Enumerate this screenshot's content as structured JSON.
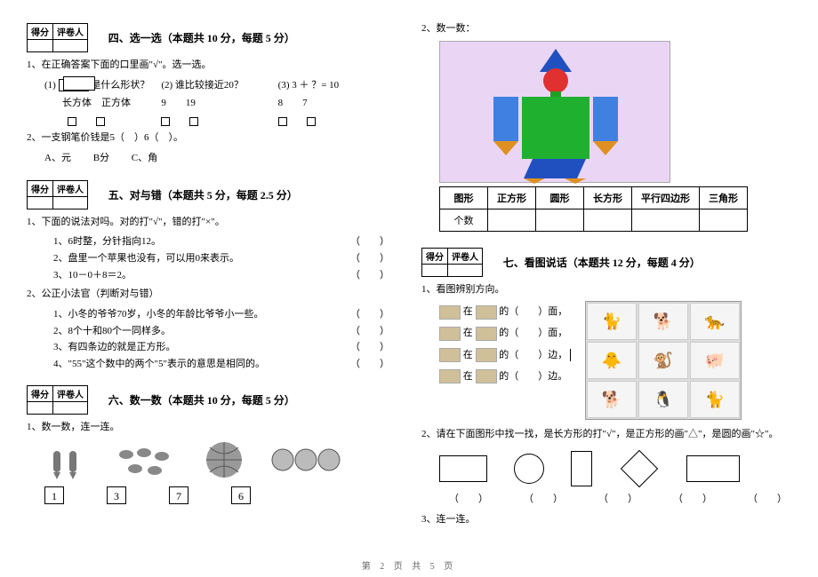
{
  "footer": "第 2 页 共 5 页",
  "score_header": {
    "c1": "得分",
    "c2": "评卷人"
  },
  "left": {
    "s4": {
      "title": "四、选一选（本题共 10 分，每题 5 分）",
      "q1": "1、在正确答案下面的口里画\"√\"。选一选。",
      "q1a_label": "(1)",
      "q1a_text": "是什么形状？",
      "q1b": "(2) 谁比较接近20？",
      "q1c": "(3) 3 ＋ ？= 10",
      "opt_a1": "长方体",
      "opt_a2": "正方体",
      "opt_b1": "9",
      "opt_b2": "19",
      "opt_c1": "8",
      "opt_c2": "7",
      "q2": "2、一支钢笔价钱是5（　）6（　）。",
      "q2a": "A、元",
      "q2b": "B分",
      "q2c": "C、角"
    },
    "s5": {
      "title": "五、对与错（本题共 5 分，每题 2.5 分）",
      "q1": "1、下面的说法对吗。对的打\"√\"，错的打\"×\"。",
      "l1": "1、6时整，分针指向12。",
      "l2": "2、盘里一个苹果也没有，可以用0来表示。",
      "l3": "3、10－0＋8＝2。",
      "q2": "2、公正小法官（判断对与错）",
      "l4": "1、小冬的爷爷70岁，小冬的年龄比爷爷小一些。",
      "l5": "2、8个十和80个一同样多。",
      "l6": "3、有四条边的就是正方形。",
      "l7": "4、\"55\"这个数中的两个\"5\"表示的意思是相同的。",
      "paren": "（　　）"
    },
    "s6": {
      "title": "六、数一数（本题共 10 分，每题 5 分）",
      "q1": "1、数一数，连一连。",
      "n1": "1",
      "n2": "3",
      "n3": "7",
      "n4": "6"
    }
  },
  "right": {
    "s6b": {
      "q2": "2、数一数："
    },
    "shape_table": {
      "h0": "图形",
      "h1": "正方形",
      "h2": "圆形",
      "h3": "长方形",
      "h4": "平行四边形",
      "h5": "三角形",
      "r0": "个数"
    },
    "s7": {
      "title": "七、看图说话（本题共 12 分，每题 4 分）",
      "q1": "1、看图辨别方向。",
      "line1a": "在",
      "line1b": "的（　　）面，",
      "line2a": "在",
      "line2b": "的（　　）面，",
      "line3a": "在",
      "line3b": "的（　　）边，",
      "line4a": "在",
      "line4b": "的（　　）边。",
      "q2": "2、请在下面图形中找一找，是长方形的打\"√\"，是正方形的画\"△\"，是圆的画\"☆\"。",
      "paren": "（　　）",
      "q3": "3、连一连。"
    }
  }
}
